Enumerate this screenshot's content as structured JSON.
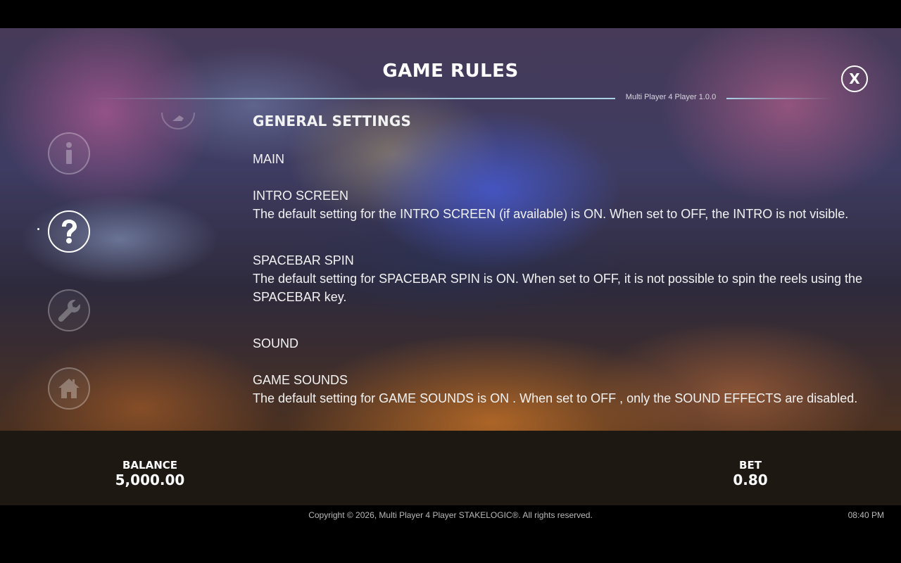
{
  "header": {
    "title": "GAME RULES",
    "version": "Multi Player 4 Player 1.0.0",
    "close_label": "X"
  },
  "nav": {
    "items": [
      {
        "name": "info",
        "icon": "info-icon",
        "active": false
      },
      {
        "name": "help",
        "icon": "question-icon",
        "active": true
      },
      {
        "name": "settings",
        "icon": "wrench-icon",
        "active": false
      },
      {
        "name": "home",
        "icon": "home-icon",
        "active": false
      }
    ]
  },
  "content": {
    "heading": "GENERAL SETTINGS",
    "sections": [
      {
        "label": "MAIN",
        "items": [
          {
            "title": "INTRO SCREEN",
            "text": "The default setting for the INTRO SCREEN (if available) is ON. When set to OFF, the INTRO is not visible."
          },
          {
            "title": "SPACEBAR SPIN",
            "text": "The default setting for SPACEBAR SPIN is ON. When set to OFF, it is not possible to spin the reels using the SPACEBAR key."
          }
        ]
      },
      {
        "label": "SOUND",
        "items": [
          {
            "title": "GAME SOUNDS",
            "text": "The default setting for GAME SOUNDS is ON . When set to OFF , only the SOUND EFFECTS are disabled."
          }
        ]
      }
    ]
  },
  "footer": {
    "balance_label": "BALANCE",
    "balance_value": "5,000.00",
    "bet_label": "BET",
    "bet_value": "0.80",
    "copyright": "Copyright © 2026, Multi Player 4 Player STAKELOGIC®. All rights reserved.",
    "time": "08:40 PM"
  },
  "colors": {
    "footer_bg": "#1e1812",
    "rule_accent": "#aad2e6",
    "text": "#ffffff"
  }
}
